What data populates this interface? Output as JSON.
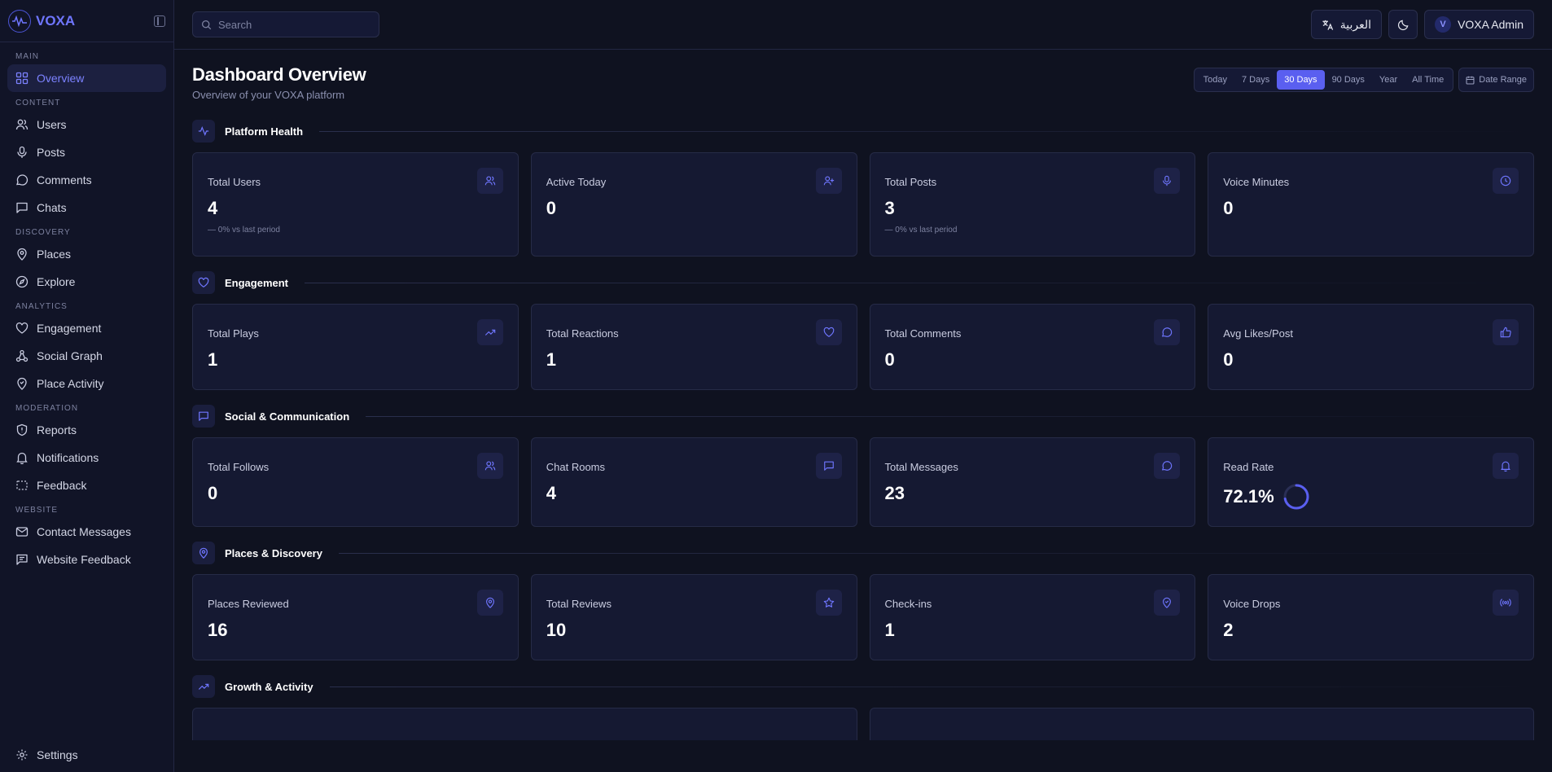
{
  "brand": {
    "name": "VOXA"
  },
  "sidebar": {
    "sections": {
      "main": "MAIN",
      "content": "CONTENT",
      "discovery": "DISCOVERY",
      "analytics": "ANALYTICS",
      "moderation": "MODERATION",
      "website": "WEBSITE"
    },
    "items": {
      "overview": "Overview",
      "users": "Users",
      "posts": "Posts",
      "comments": "Comments",
      "chats": "Chats",
      "places": "Places",
      "explore": "Explore",
      "engagement": "Engagement",
      "social_graph": "Social Graph",
      "place_activity": "Place Activity",
      "reports": "Reports",
      "notifications": "Notifications",
      "feedback": "Feedback",
      "contact_messages": "Contact Messages",
      "website_feedback": "Website Feedback",
      "settings": "Settings"
    }
  },
  "topbar": {
    "search_placeholder": "Search",
    "language": "العربية",
    "user_initial": "V",
    "user_name": "VOXA Admin"
  },
  "page": {
    "title": "Dashboard Overview",
    "subtitle": "Overview of your VOXA platform"
  },
  "filters": {
    "ranges": [
      "Today",
      "7 Days",
      "30 Days",
      "90 Days",
      "Year",
      "All Time"
    ],
    "active": "30 Days",
    "date_range": "Date Range"
  },
  "sections": {
    "platform_health": {
      "title": "Platform Health",
      "cards": [
        {
          "label": "Total Users",
          "value": "4",
          "trend": "0% vs last period",
          "icon": "users-icon"
        },
        {
          "label": "Active Today",
          "value": "0",
          "icon": "user-plus-icon"
        },
        {
          "label": "Total Posts",
          "value": "3",
          "trend": "0% vs last period",
          "icon": "mic-icon"
        },
        {
          "label": "Voice Minutes",
          "value": "0",
          "icon": "clock-icon"
        }
      ]
    },
    "engagement": {
      "title": "Engagement",
      "cards": [
        {
          "label": "Total Plays",
          "value": "1",
          "icon": "trending-up-icon"
        },
        {
          "label": "Total Reactions",
          "value": "1",
          "icon": "heart-icon"
        },
        {
          "label": "Total Comments",
          "value": "0",
          "icon": "message-circle-icon"
        },
        {
          "label": "Avg Likes/Post",
          "value": "0",
          "icon": "thumbs-up-icon"
        }
      ]
    },
    "social": {
      "title": "Social & Communication",
      "cards": [
        {
          "label": "Total Follows",
          "value": "0",
          "icon": "users-icon"
        },
        {
          "label": "Chat Rooms",
          "value": "4",
          "icon": "message-square-icon"
        },
        {
          "label": "Total Messages",
          "value": "23",
          "icon": "message-circle-icon"
        },
        {
          "label": "Read Rate",
          "value": "72.1%",
          "icon": "bell-icon",
          "ring_fraction": 0.721
        }
      ]
    },
    "places": {
      "title": "Places & Discovery",
      "cards": [
        {
          "label": "Places Reviewed",
          "value": "16",
          "icon": "map-pin-icon"
        },
        {
          "label": "Total Reviews",
          "value": "10",
          "icon": "star-icon"
        },
        {
          "label": "Check-ins",
          "value": "1",
          "icon": "map-pin-check-icon"
        },
        {
          "label": "Voice Drops",
          "value": "2",
          "icon": "radio-icon"
        }
      ]
    },
    "growth": {
      "title": "Growth & Activity"
    }
  },
  "colors": {
    "accent": "#5a5ff0",
    "background": "#0f1220",
    "card": "#151932"
  }
}
